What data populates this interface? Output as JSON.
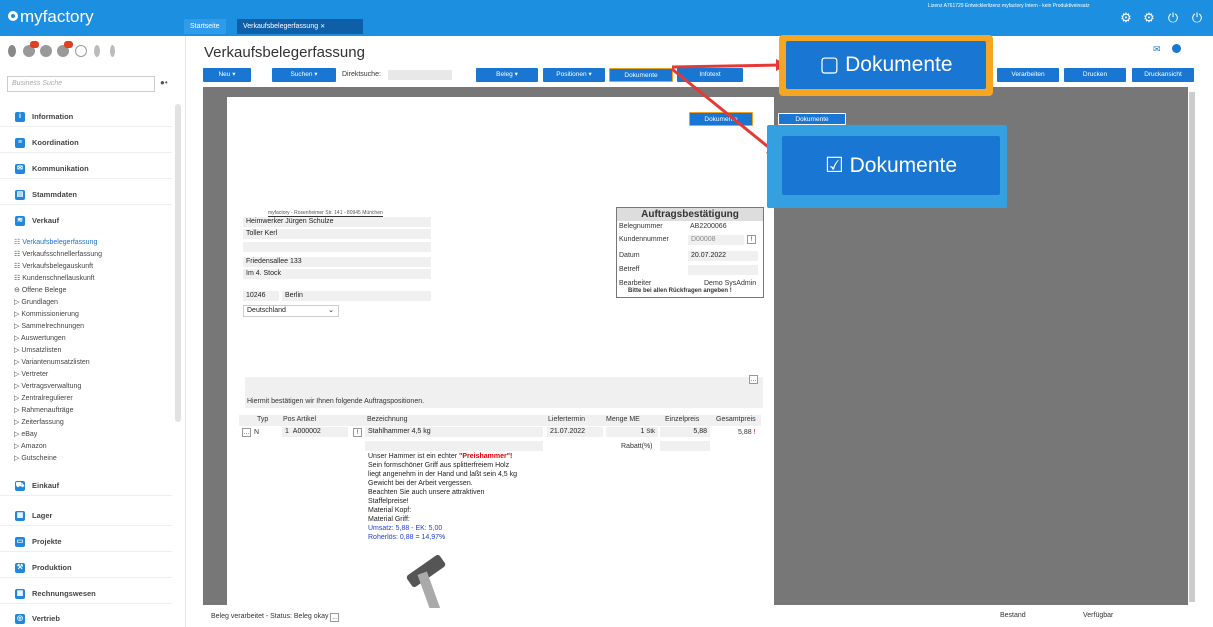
{
  "app": {
    "logo": "myfactory",
    "license": "Lizenz A761729 Entwicklerlizenz myfactory Intern - kein Produktiveinsatz"
  },
  "tabs": [
    {
      "label": "Startseite"
    },
    {
      "label": "Verkaufsbelegerfassung"
    }
  ],
  "sidebar": {
    "search_placeholder": "Business Suche",
    "categories": [
      {
        "label": "Information"
      },
      {
        "label": "Koordination"
      },
      {
        "label": "Kommunikation"
      },
      {
        "label": "Stammdaten"
      },
      {
        "label": "Verkauf"
      },
      {
        "label": "Einkauf"
      },
      {
        "label": "Lager"
      },
      {
        "label": "Projekte"
      },
      {
        "label": "Produktion"
      },
      {
        "label": "Rechnungswesen"
      },
      {
        "label": "Vertrieb"
      }
    ],
    "verkauf_items": [
      {
        "label": "Verkaufsbelegerfassung"
      },
      {
        "label": "Verkaufsschnellerfassung"
      },
      {
        "label": "Verkaufsbelegauskunft"
      },
      {
        "label": "Kundenschnellauskunft"
      },
      {
        "label": "Offene Belege"
      },
      {
        "label": "Grundlagen"
      },
      {
        "label": "Kommissionierung"
      },
      {
        "label": "Sammelrechnungen"
      },
      {
        "label": "Auswertungen"
      },
      {
        "label": "Umsatzlisten"
      },
      {
        "label": "Variantenumsatzlisten"
      },
      {
        "label": "Vertreter"
      },
      {
        "label": "Vertragsverwaltung"
      },
      {
        "label": "Zentralregulierer"
      },
      {
        "label": "Rahmenaufträge"
      },
      {
        "label": "Zeiterfassung"
      },
      {
        "label": "eBay"
      },
      {
        "label": "Amazon"
      },
      {
        "label": "Gutscheine"
      }
    ]
  },
  "main": {
    "title": "Verkaufsbelegerfassung",
    "toolbar": {
      "neu": "Neu",
      "suchen": "Suchen",
      "direktsuche": "Direktsuche:",
      "beleg": "Beleg",
      "positionen": "Positionen",
      "dokumente": "Dokumente",
      "infotext": "Infotext",
      "verarbeiten": "Verarbeiten",
      "drucken": "Drucken",
      "druckansicht": "Druckansicht"
    },
    "callouts": {
      "dokumente_large": "Dokumente",
      "dokumente_small": "Dokumente"
    },
    "sender": "myfactory - Rosenheimer Str. 141 - 80945 München",
    "address": {
      "name": "Heimwerker Jürgen Schulze",
      "contact": "Toller Kerl",
      "street": "Friedensallee 133",
      "extra": "Im 4. Stock",
      "zip": "10246",
      "city": "Berlin",
      "country": "Deutschland"
    },
    "confirm": {
      "title": "Auftragsbestätigung",
      "belegnummer_lbl": "Belegnummer",
      "belegnummer": "AB2200066",
      "kundennummer_lbl": "Kundennummer",
      "kundennummer": "D00008",
      "datum_lbl": "Datum",
      "datum": "20.07.2022",
      "betreff_lbl": "Betreff",
      "bearbeiter_lbl": "Bearbeiter",
      "bearbeiter": "Demo SysAdmin",
      "note": "Bitte bei allen Rückfragen angeben !"
    },
    "intro": "Hiermit bestätigen wir Ihnen folgende Auftragspositionen.",
    "table": {
      "headers": {
        "typ": "Typ",
        "pos": "Pos Artikel",
        "bez": "Bezeichnung",
        "termin": "Liefertermin",
        "menge": "Menge ME",
        "ep": "Einzelpreis",
        "gp": "Gesamtpreis"
      },
      "row": {
        "typ": "N",
        "pos": "1",
        "artikel": "A000002",
        "bez": "Stahlhammer 4,5 kg",
        "termin": "21.07.2022",
        "menge": "1",
        "me": "Stk",
        "ep": "5,88",
        "gp": "5,88",
        "rabatt": "Rabatt(%)"
      }
    },
    "desc": {
      "l1a": "Unser Hammer ist ein echter ",
      "l1b": "\"Preishammer\"!",
      "l2": "Sein formschöner Griff aus splitterfreiem Holz",
      "l3": "liegt angenehm in der Hand und laßt sein 4,5 kg",
      "l4": "Gewicht bei der Arbeit vergessen.",
      "l5": "Beachten Sie auch unsere attraktiven",
      "l6": "Staffelpreise!",
      "l7": "Material Kopf:",
      "l8": "Material Griff:",
      "l9": "Umsatz: 5,88 - EK: 5,00",
      "l10": "Roherlös: 0,88 = 14,97%"
    },
    "status": "Beleg verarbeitet - Status: Beleg okay",
    "bestand": "Bestand",
    "verfuegbar": "Verfügbar"
  }
}
